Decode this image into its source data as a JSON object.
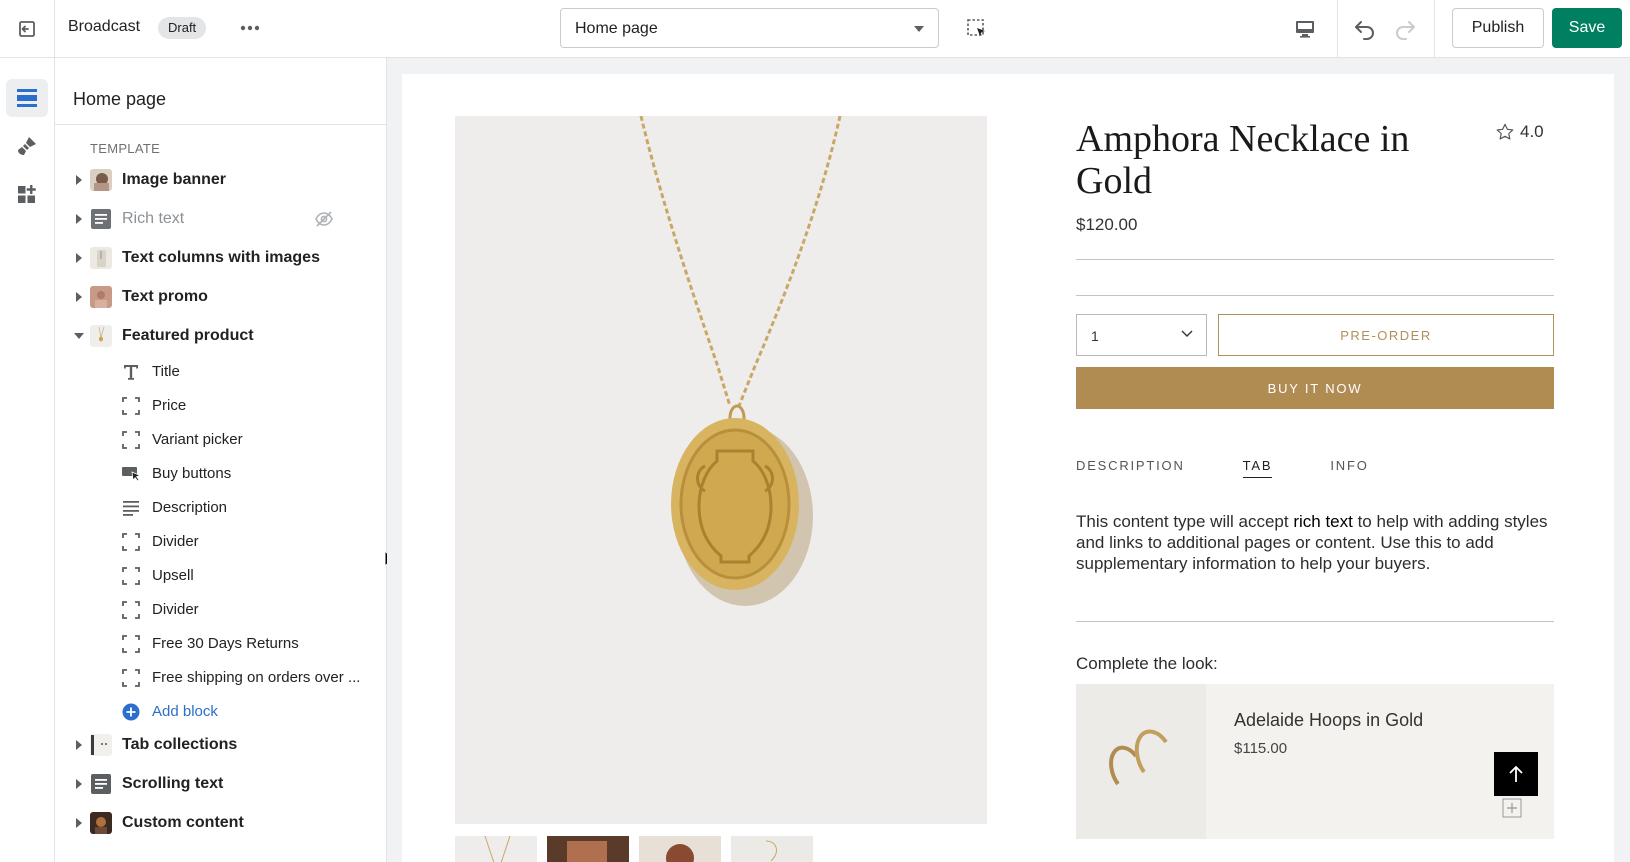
{
  "topbar": {
    "app_name": "Broadcast",
    "status_badge": "Draft",
    "page_select_value": "Home page",
    "publish_label": "Publish",
    "save_label": "Save"
  },
  "sidebar": {
    "title": "Home page",
    "template_heading": "TEMPLATE",
    "sections": [
      {
        "label": "Image banner",
        "expanded": false,
        "hidden": false
      },
      {
        "label": "Rich text",
        "expanded": false,
        "hidden": true
      },
      {
        "label": "Text columns with images",
        "expanded": false,
        "hidden": false
      },
      {
        "label": "Text promo",
        "expanded": false,
        "hidden": false
      },
      {
        "label": "Featured product",
        "expanded": true,
        "hidden": false
      },
      {
        "label": "Tab collections",
        "expanded": false,
        "hidden": false
      },
      {
        "label": "Scrolling text",
        "expanded": false,
        "hidden": false
      },
      {
        "label": "Custom content",
        "expanded": false,
        "hidden": false
      }
    ],
    "featured_blocks": [
      {
        "label": "Title",
        "icon": "text-icon"
      },
      {
        "label": "Price",
        "icon": "block-icon"
      },
      {
        "label": "Variant picker",
        "icon": "block-icon"
      },
      {
        "label": "Buy buttons",
        "icon": "buy-button-icon"
      },
      {
        "label": "Description",
        "icon": "paragraph-icon"
      },
      {
        "label": "Divider",
        "icon": "block-icon"
      },
      {
        "label": "Upsell",
        "icon": "block-icon"
      },
      {
        "label": "Divider",
        "icon": "block-icon"
      },
      {
        "label": "Free 30 Days Returns",
        "icon": "block-icon"
      },
      {
        "label": "Free shipping on orders over ...",
        "icon": "block-icon"
      }
    ],
    "add_block_label": "Add block"
  },
  "preview": {
    "product_title": "Amphora Necklace in Gold",
    "rating": "4.0",
    "price": "$120.00",
    "quantity": "1",
    "preorder_label": "PRE-ORDER",
    "buy_now_label": "BUY IT NOW",
    "tabs": [
      "DESCRIPTION",
      "TAB",
      "INFO"
    ],
    "active_tab": "TAB",
    "description_before": "This content type will accept ",
    "description_bold": "rich text",
    "description_after": " to help with adding styles and links to additional pages or content. Use this to add supplementary information to help your buyers.",
    "complete_look_label": "Complete the look:",
    "upsell_name": "Adelaide Hoops in Gold",
    "upsell_price": "$115.00"
  },
  "colors": {
    "save_green": "#008060",
    "gold_accent": "#b08c52",
    "link_blue": "#2c6ecb"
  }
}
